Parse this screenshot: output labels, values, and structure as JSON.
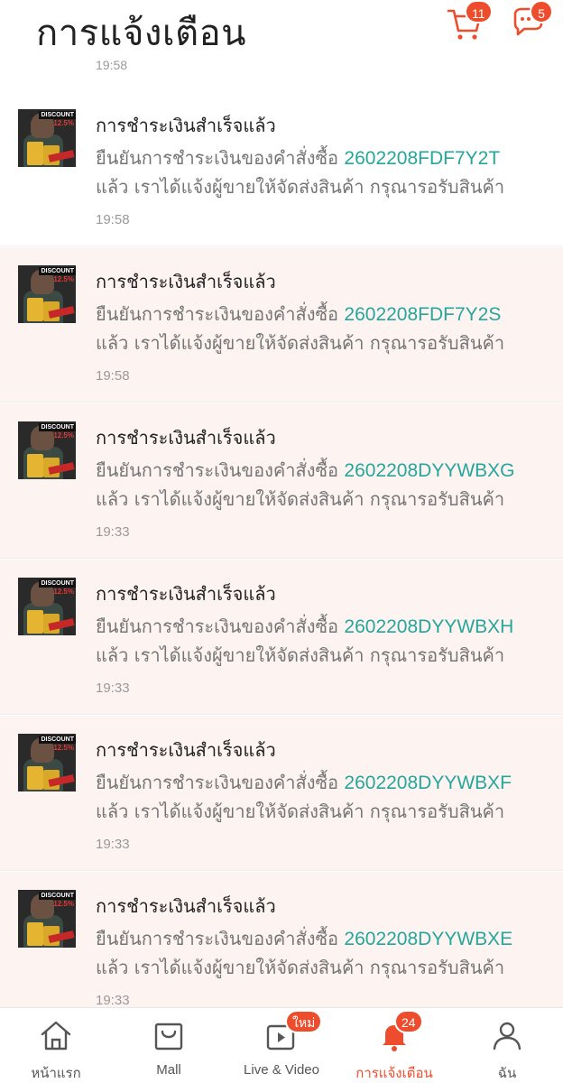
{
  "header": {
    "title": "การแจ้งเตือน",
    "cart_badge": "11",
    "chat_badge": "5"
  },
  "list": {
    "top_partial_time": "19:58",
    "items": [
      {
        "title": "การชำระเงินสำเร็จแล้ว",
        "line1_prefix": "ยืนยันการชำระเงินของคำสั่งซื้อ ",
        "order_id": "2602208FDF7Y2T",
        "line2": "แล้ว เราได้แจ้งผู้ขายให้จัดส่งสินค้า กรุณารอรับสินค้า",
        "time": "19:58",
        "read": true
      },
      {
        "title": "การชำระเงินสำเร็จแล้ว",
        "line1_prefix": "ยืนยันการชำระเงินของคำสั่งซื้อ ",
        "order_id": "2602208FDF7Y2S",
        "line2": "แล้ว เราได้แจ้งผู้ขายให้จัดส่งสินค้า กรุณารอรับสินค้า",
        "time": "19:58",
        "read": false
      },
      {
        "title": "การชำระเงินสำเร็จแล้ว",
        "line1_prefix": "ยืนยันการชำระเงินของคำสั่งซื้อ ",
        "order_id": "2602208DYYWBXG",
        "line2": "แล้ว เราได้แจ้งผู้ขายให้จัดส่งสินค้า กรุณารอรับสินค้า",
        "time": "19:33",
        "read": false
      },
      {
        "title": "การชำระเงินสำเร็จแล้ว",
        "line1_prefix": "ยืนยันการชำระเงินของคำสั่งซื้อ ",
        "order_id": "2602208DYYWBXH",
        "line2": "แล้ว เราได้แจ้งผู้ขายให้จัดส่งสินค้า กรุณารอรับสินค้า",
        "time": "19:33",
        "read": false
      },
      {
        "title": "การชำระเงินสำเร็จแล้ว",
        "line1_prefix": "ยืนยันการชำระเงินของคำสั่งซื้อ ",
        "order_id": "2602208DYYWBXF",
        "line2": "แล้ว เราได้แจ้งผู้ขายให้จัดส่งสินค้า กรุณารอรับสินค้า",
        "time": "19:33",
        "read": false
      },
      {
        "title": "การชำระเงินสำเร็จแล้ว",
        "line1_prefix": "ยืนยันการชำระเงินของคำสั่งซื้อ ",
        "order_id": "2602208DYYWBXE",
        "line2": "แล้ว เราได้แจ้งผู้ขายให้จัดส่งสินค้า กรุณารอรับสินค้า",
        "time": "19:33",
        "read": false
      }
    ],
    "thumb_text_1": "DISCOUNT",
    "thumb_text_2": "12.5%"
  },
  "tabbar": {
    "home": "หน้าแรก",
    "mall": "Mall",
    "live": "Live & Video",
    "live_badge": "ใหม่",
    "notifications": "การแจ้งเตือน",
    "notifications_badge": "24",
    "me": "ฉัน"
  },
  "colors": {
    "accent": "#ee4d2d",
    "order_link": "#26a69a",
    "unread_bg": "#fdf4f2"
  }
}
